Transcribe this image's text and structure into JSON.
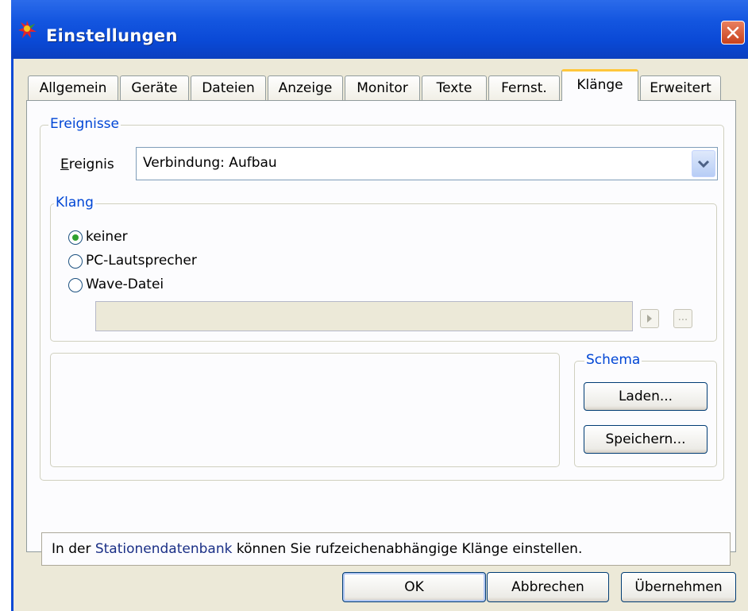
{
  "window": {
    "title": "Einstellungen",
    "app_icon": "colorful-app-icon",
    "close_icon": "close-icon"
  },
  "tabs": [
    {
      "label": "Allgemein",
      "active": false
    },
    {
      "label": "Geräte",
      "active": false
    },
    {
      "label": "Dateien",
      "active": false
    },
    {
      "label": "Anzeige",
      "active": false
    },
    {
      "label": "Monitor",
      "active": false
    },
    {
      "label": "Texte",
      "active": false
    },
    {
      "label": "Fernst.",
      "active": false
    },
    {
      "label": "Klänge",
      "active": true
    },
    {
      "label": "Erweitert",
      "active": false
    }
  ],
  "events_group": {
    "legend": "Ereignisse",
    "event_label_first": "E",
    "event_label_rest": "reignis",
    "event_value": "Verbindung: Aufbau"
  },
  "sound_group": {
    "legend": "Klang",
    "options": [
      {
        "label": "keiner",
        "selected": true
      },
      {
        "label": "PC-Lautsprecher",
        "selected": false
      },
      {
        "label": "Wave-Datei",
        "selected": false
      }
    ],
    "wave_file_value": "",
    "play_button_icon": "play-icon",
    "browse_button_label": "..."
  },
  "schema_group": {
    "legend": "Schema",
    "load_label": "Laden...",
    "save_label": "Speichern..."
  },
  "info": {
    "prefix": "In der ",
    "link": "Stationendatenbank",
    "suffix": " können Sie rufzeichenabhängige Klänge einstellen."
  },
  "footer": {
    "ok_label": "OK",
    "cancel_label": "Abbrechen",
    "apply_label": "Übernehmen"
  },
  "colors": {
    "titlebar": "#0a49d6",
    "group_legend": "#0046d5",
    "active_tab_highlight": "#ffc73c",
    "link": "#1a2f86"
  }
}
